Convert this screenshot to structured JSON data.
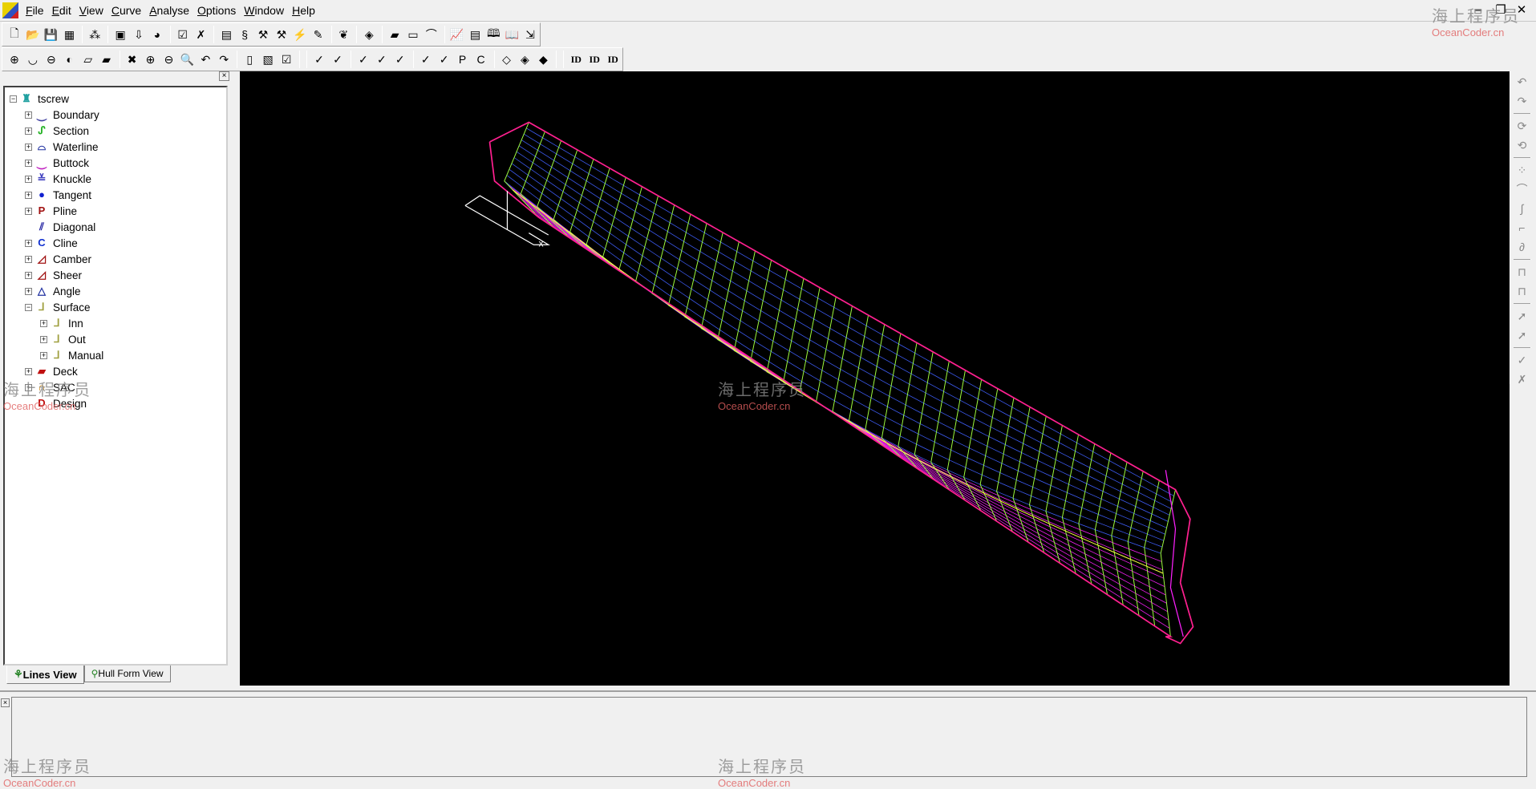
{
  "menu": [
    "File",
    "Edit",
    "View",
    "Curve",
    "Analyse",
    "Options",
    "Window",
    "Help"
  ],
  "window_controls": {
    "minimize": "–",
    "restore": "❐",
    "close": "✕"
  },
  "toolbar1": [
    {
      "icon": "new-file-icon",
      "g": "🗋"
    },
    {
      "icon": "open-folder-icon",
      "g": "📂"
    },
    {
      "icon": "save-icon",
      "g": "💾"
    },
    {
      "icon": "properties-icon",
      "g": "▦"
    },
    "sep",
    {
      "icon": "network-icon",
      "g": "⁂"
    },
    "sep",
    {
      "icon": "formula-icon",
      "g": "▣"
    },
    {
      "icon": "import-icon",
      "g": "⇩"
    },
    {
      "icon": "render-sphere-icon",
      "g": "◕"
    },
    "sep",
    {
      "icon": "checkbox-tool-icon",
      "g": "☑"
    },
    {
      "icon": "cross-tool-icon",
      "g": "✗"
    },
    "sep",
    {
      "icon": "grid-icon",
      "g": "▤"
    },
    {
      "icon": "curves-icon",
      "g": "§"
    },
    {
      "icon": "hammer-icon",
      "g": "⚒"
    },
    {
      "icon": "hammer-box-icon",
      "g": "⚒"
    },
    {
      "icon": "lightning-icon",
      "g": "⚡"
    },
    {
      "icon": "pencil-icon",
      "g": "✎"
    },
    "sep",
    {
      "icon": "fairing-icon",
      "g": "❦"
    },
    "sep",
    {
      "icon": "mesh-icon",
      "g": "◈"
    },
    "sep",
    {
      "icon": "deck-icon",
      "g": "▰"
    },
    {
      "icon": "sac-bar-icon",
      "g": "▭"
    },
    {
      "icon": "sac-curve-icon",
      "g": "⌒"
    },
    "sep",
    {
      "icon": "chart-icon",
      "g": "📈"
    },
    {
      "icon": "table-icon",
      "g": "▤"
    },
    {
      "icon": "book-icon",
      "g": "🕮"
    },
    {
      "icon": "open-book-icon",
      "g": "📖"
    },
    {
      "icon": "export-icon",
      "g": "⇲"
    }
  ],
  "toolbar2": [
    {
      "icon": "view-body-icon",
      "g": "⊕"
    },
    {
      "icon": "view-plan-icon",
      "g": "◡"
    },
    {
      "icon": "view-profile-icon",
      "g": "⊖"
    },
    {
      "icon": "view-side-icon",
      "g": "◐"
    },
    {
      "icon": "view-top-icon",
      "g": "▱"
    },
    {
      "icon": "view-3d-icon",
      "g": "▰"
    },
    "sep",
    {
      "icon": "zoom-extents-icon",
      "g": "✖"
    },
    {
      "icon": "zoom-in-icon",
      "g": "⊕"
    },
    {
      "icon": "zoom-out-icon",
      "g": "⊖"
    },
    {
      "icon": "zoom-window-icon",
      "g": "🔍"
    },
    {
      "icon": "zoom-previous-icon",
      "g": "↶"
    },
    {
      "icon": "zoom-next-icon",
      "g": "↷"
    },
    "sep",
    {
      "icon": "page-icon",
      "g": "▯"
    },
    {
      "icon": "page-edit-icon",
      "g": "▧"
    },
    {
      "icon": "page-check-icon",
      "g": "☑"
    },
    "sep",
    "sep",
    {
      "icon": "all-curves-icon",
      "g": "✓"
    },
    {
      "icon": "boundary-edit-icon",
      "g": "✓"
    },
    "sep",
    {
      "icon": "section-edit-icon",
      "g": "✓"
    },
    {
      "icon": "waterline-edit-icon",
      "g": "✓"
    },
    {
      "icon": "buttock-edit-icon",
      "g": "✓"
    },
    "sep",
    {
      "icon": "knuckle-edit-icon",
      "g": "✓"
    },
    {
      "icon": "tangent-edit-icon",
      "g": "✓"
    },
    {
      "icon": "pline-edit-icon",
      "g": "P"
    },
    {
      "icon": "cline-edit-icon",
      "g": "C"
    },
    "sep",
    {
      "icon": "surface-edit-icon",
      "g": "◇"
    },
    {
      "icon": "surface-mesh-icon",
      "g": "◈"
    },
    {
      "icon": "surface-fair-icon",
      "g": "◆"
    },
    "sep",
    "sep",
    {
      "icon": "id-icon",
      "g": "ID"
    },
    {
      "icon": "id-move-icon",
      "g": "ID"
    },
    {
      "icon": "id-update-icon",
      "g": "ID"
    }
  ],
  "right_toolbar": [
    {
      "icon": "undo-icon",
      "g": "↶"
    },
    {
      "icon": "redo-icon",
      "g": "↷"
    },
    "sep",
    {
      "icon": "rotate-cw-icon",
      "g": "⟳"
    },
    {
      "icon": "rotate-ccw-icon",
      "g": "⟲"
    },
    "sep",
    {
      "icon": "points-icon",
      "g": "⁘"
    },
    {
      "icon": "curve-icon",
      "g": "⌒"
    },
    {
      "icon": "spline-icon",
      "g": "∫"
    },
    {
      "icon": "polyline-icon",
      "g": "⌐"
    },
    {
      "icon": "curve-node-icon",
      "g": "∂"
    },
    "sep",
    {
      "icon": "offset-icon",
      "g": "⊓"
    },
    {
      "icon": "offset-alt-icon",
      "g": "⊓"
    },
    "sep",
    {
      "icon": "select-surface-icon",
      "g": "➚"
    },
    {
      "icon": "select-curve-icon",
      "g": "➚"
    },
    "sep",
    {
      "icon": "trim-icon",
      "g": "✓"
    },
    {
      "icon": "delete-curve-icon",
      "g": "✗"
    }
  ],
  "tree": {
    "root": "tscrew",
    "items": [
      {
        "label": "Boundary",
        "icon": "boundary-icon",
        "g": "⏝",
        "color": "#4040a0",
        "level": 1,
        "exp": "+"
      },
      {
        "label": "Section",
        "icon": "section-icon",
        "g": "ᔑ",
        "color": "#20b020",
        "level": 1,
        "exp": "+"
      },
      {
        "label": "Waterline",
        "icon": "waterline-icon",
        "g": "⌓",
        "color": "#2030a0",
        "level": 1,
        "exp": "+"
      },
      {
        "label": "Buttock",
        "icon": "buttock-icon",
        "g": "⏝",
        "color": "#c020c0",
        "level": 1,
        "exp": "+"
      },
      {
        "label": "Knuckle",
        "icon": "knuckle-icon",
        "g": "≚",
        "color": "#4040c0",
        "level": 1,
        "exp": "+"
      },
      {
        "label": "Tangent",
        "icon": "tangent-icon",
        "g": "●",
        "color": "#1020d0",
        "level": 1,
        "exp": "+"
      },
      {
        "label": "Pline",
        "icon": "pline-icon",
        "g": "P",
        "color": "#a01010",
        "level": 1,
        "exp": "+"
      },
      {
        "label": "Diagonal",
        "icon": "diagonal-icon",
        "g": "⫽",
        "color": "#2020a0",
        "level": 1,
        "exp": ""
      },
      {
        "label": "Cline",
        "icon": "cline-icon",
        "g": "C",
        "color": "#1030d0",
        "level": 1,
        "exp": "+"
      },
      {
        "label": "Camber",
        "icon": "camber-icon",
        "g": "◿",
        "color": "#a01010",
        "level": 1,
        "exp": "+"
      },
      {
        "label": "Sheer",
        "icon": "sheer-icon",
        "g": "◿",
        "color": "#a01010",
        "level": 1,
        "exp": "+"
      },
      {
        "label": "Angle",
        "icon": "angle-icon",
        "g": "△",
        "color": "#2030a0",
        "level": 1,
        "exp": "+"
      },
      {
        "label": "Surface",
        "icon": "surface-icon",
        "g": "⅃",
        "color": "#a0a040",
        "level": 1,
        "exp": "-"
      },
      {
        "label": "Inn",
        "icon": "surface-inn-icon",
        "g": "⅃",
        "color": "#a0a040",
        "level": 2,
        "exp": "+"
      },
      {
        "label": "Out",
        "icon": "surface-out-icon",
        "g": "⅃",
        "color": "#a0a040",
        "level": 2,
        "exp": "+"
      },
      {
        "label": "Manual",
        "icon": "surface-manual-icon",
        "g": "⅃",
        "color": "#a0a040",
        "level": 2,
        "exp": "+"
      },
      {
        "label": "Deck",
        "icon": "deck-icon",
        "g": "▰",
        "color": "#c01010",
        "level": 1,
        "exp": "+"
      },
      {
        "label": "SAC",
        "icon": "sac-icon",
        "g": "∩",
        "color": "#d08000",
        "level": 1,
        "exp": "+"
      },
      {
        "label": "Design",
        "icon": "design-icon",
        "g": "D",
        "color": "#c01010",
        "level": 1,
        "exp": ""
      }
    ]
  },
  "tabs": [
    {
      "label": "Lines View",
      "active": true
    },
    {
      "label": "Hull Form View",
      "active": false
    }
  ],
  "viewport": {
    "axis_label": "x",
    "colors": {
      "background": "#000000",
      "section": "#a0ff40",
      "waterline": "#4060ff",
      "buttock": "#ff20ff",
      "outline": "#ff2090",
      "diagonal": "#ffff40"
    }
  },
  "watermark": {
    "cn": "海上程序员",
    "en": "OceanCoder.cn"
  }
}
